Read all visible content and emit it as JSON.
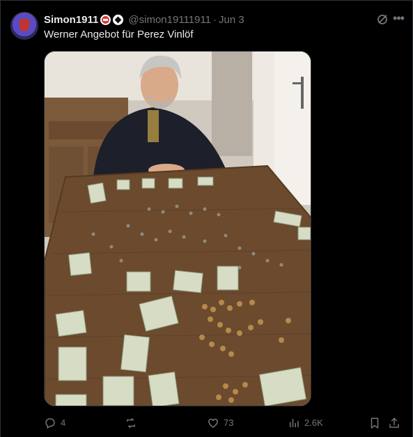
{
  "tweet": {
    "author_name": "Simon1911",
    "handle": "@simon19111911",
    "separator": "·",
    "date": "Jun 3",
    "text": "Werner Angebot für Perez Vinlöf",
    "image_subject": "man-seated-behind-table-covered-in-coins-and-banknotes"
  },
  "actions": {
    "replies": "4",
    "retweets": "",
    "likes": "73",
    "views": "2.6K"
  },
  "colors": {
    "background": "#000000",
    "text": "#e7e9ea",
    "muted": "#71767b",
    "border": "#2f3336"
  },
  "icons": [
    "reply-icon",
    "retweet-icon",
    "like-icon",
    "views-icon",
    "bookmark-icon",
    "share-icon",
    "grok-icon",
    "more-icon"
  ]
}
